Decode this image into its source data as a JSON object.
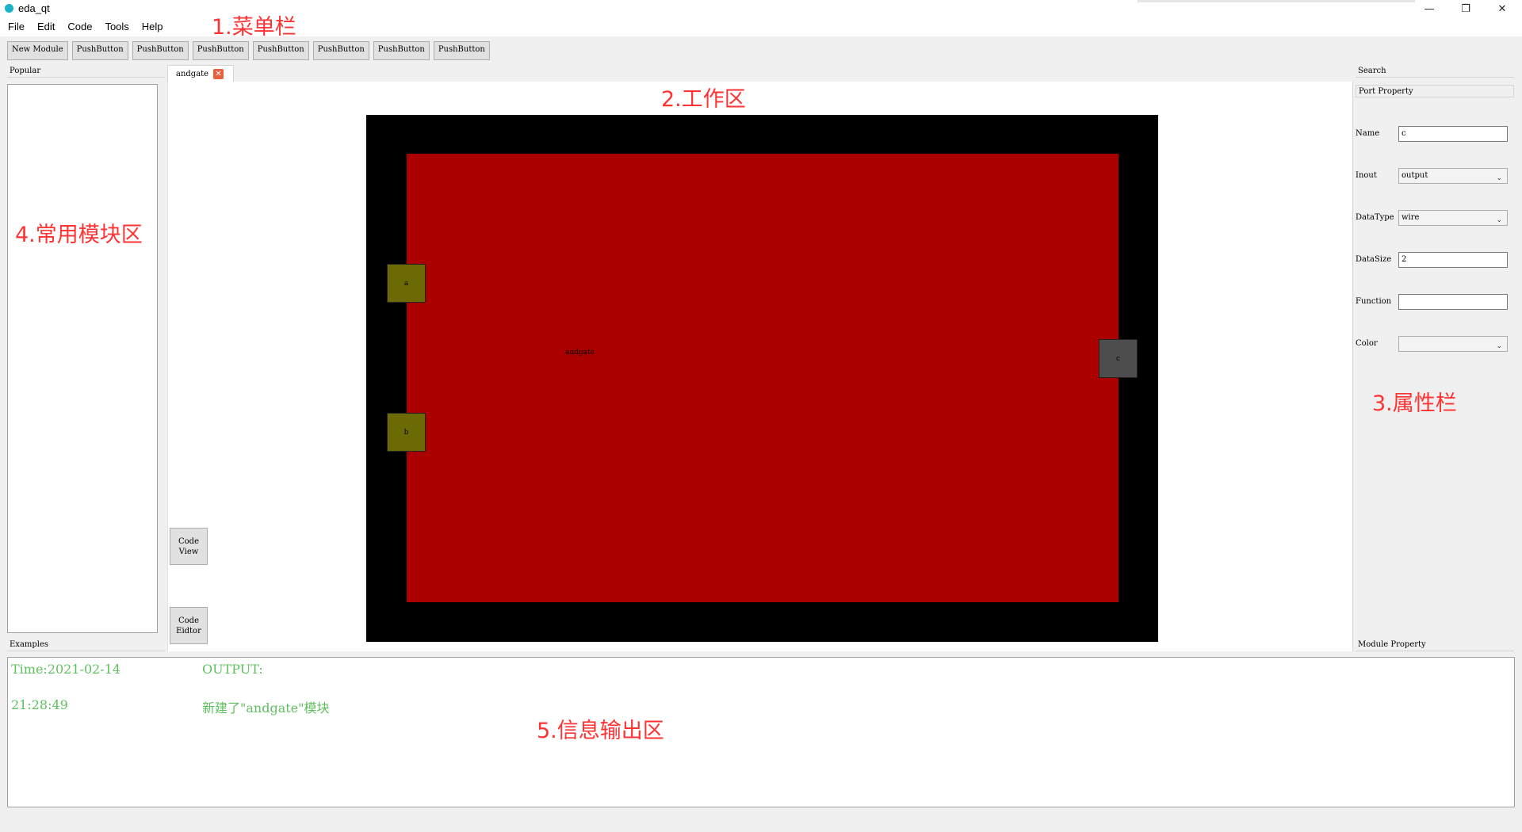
{
  "window": {
    "title": "eda_qt",
    "minimize_glyph": "—",
    "restore_glyph": "❐",
    "close_glyph": "✕"
  },
  "menu": [
    "File",
    "Edit",
    "Code",
    "Tools",
    "Help"
  ],
  "toolbar": [
    "New Module",
    "PushButton",
    "PushButton",
    "PushButton",
    "PushButton",
    "PushButton",
    "PushButton",
    "PushButton"
  ],
  "left_dock": {
    "popular_title": "Popular",
    "examples_title": "Examples"
  },
  "tab": {
    "label": "andgate",
    "close_glyph": "✕"
  },
  "canvas": {
    "module_label": "andgate",
    "ports": {
      "a": "a",
      "b": "b",
      "c": "c"
    },
    "colors": {
      "border": "#000000",
      "body": "#aa0000",
      "input_port": "#6b6a05",
      "output_port": "#4d4d4d"
    }
  },
  "side_buttons": {
    "code_view": [
      "Code",
      "View"
    ],
    "code_editor": [
      "Code",
      "Eidtor"
    ]
  },
  "right_dock": {
    "search_title": "Search",
    "port_property_title": "Port Property",
    "module_property_title": "Module Property",
    "fields": {
      "name": {
        "label": "Name",
        "value": "c"
      },
      "inout": {
        "label": "Inout",
        "value": "output"
      },
      "datatype": {
        "label": "DataType",
        "value": "wire"
      },
      "datasize": {
        "label": "DataSize",
        "value": "2"
      },
      "function": {
        "label": "Function",
        "value": ""
      },
      "color": {
        "label": "Color",
        "value": ""
      }
    }
  },
  "output": {
    "time_line1": "Time:2021-02-14",
    "time_line2": "21:28:49",
    "header": "OUTPUT:",
    "message": "新建了\"andgate\"模块"
  },
  "annotations": {
    "menu": "1.菜单栏",
    "work": "2.工作区",
    "property": "3.属性栏",
    "popular": "4.常用模块区",
    "output": "5.信息输出区"
  }
}
